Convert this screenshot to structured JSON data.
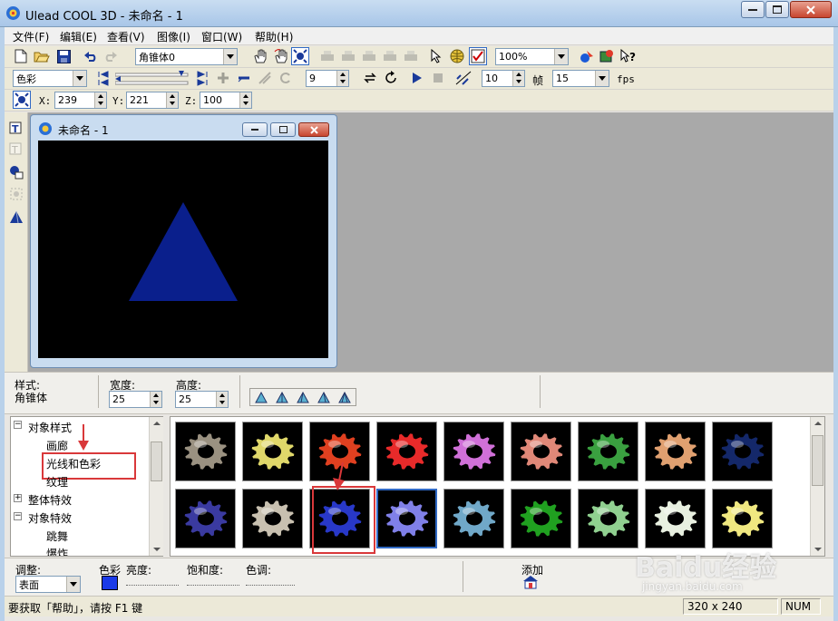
{
  "app": {
    "title": "Ulead COOL 3D - 未命名 - 1"
  },
  "menu": [
    "文件(F)",
    "编辑(E)",
    "查看(V)",
    "图像(I)",
    "窗口(W)",
    "帮助(H)"
  ],
  "toolbar1": {
    "object_combo": "角锥体0",
    "zoom_combo": "100%"
  },
  "toolbar2": {
    "attribute_combo": "色彩",
    "frame_value": "9",
    "frames_value": "10",
    "frames_label": "帧",
    "fps_value": "15",
    "fps_label": "fps"
  },
  "toolbar3": {
    "x_label": "X:",
    "x_value": "239",
    "y_label": "Y:",
    "y_value": "221",
    "z_label": "Z:",
    "z_value": "100"
  },
  "document": {
    "title": "未命名 - 1",
    "shape_color": "#0a1f8c",
    "canvas_color": "#000000"
  },
  "properties": {
    "style_label": "样式:",
    "style_value": "角锥体",
    "width_label": "宽度:",
    "width_value": "25",
    "height_label": "高度:",
    "height_value": "25"
  },
  "tree": {
    "items": [
      {
        "label": "对象样式",
        "expand": "minus",
        "level": 0
      },
      {
        "label": "画廊",
        "level": 1
      },
      {
        "label": "光线和色彩",
        "level": 1,
        "highlighted": true
      },
      {
        "label": "纹理",
        "level": 1
      },
      {
        "label": "整体特效",
        "expand": "plus",
        "level": 0
      },
      {
        "label": "对象特效",
        "expand": "minus",
        "level": 0
      },
      {
        "label": "跳舞",
        "level": 1
      },
      {
        "label": "爆炸",
        "level": 1
      }
    ]
  },
  "gallery": {
    "row1": [
      "#9a9181",
      "#e0d86a",
      "#e04020",
      "#e82a2a",
      "#d070d8",
      "#e08878",
      "#3aa040",
      "#e0a070",
      "#14286a"
    ],
    "row2": [
      "#3a3aa0",
      "#c8c0b0",
      "#2838c8",
      "#8080e8",
      "#70a8c8",
      "#20a020",
      "#90d090",
      "#e8f0e0",
      "#f0e880"
    ],
    "selected_row": 2,
    "selected_index": 3
  },
  "bottom": {
    "adjust_label": "调整:",
    "adjust_value": "表面",
    "color_label": "色彩",
    "color_value": "#1a3ae8",
    "brightness_label": "亮度:",
    "saturation_label": "饱和度:",
    "hue_label": "色调:",
    "add_label": "添加"
  },
  "status": {
    "help_text": "要获取「帮助」，请按 F1 键",
    "size": "320 x 240",
    "num": "NUM"
  },
  "watermark": {
    "brand": "Baidu经验",
    "url": "jingyan.baidu.com"
  }
}
